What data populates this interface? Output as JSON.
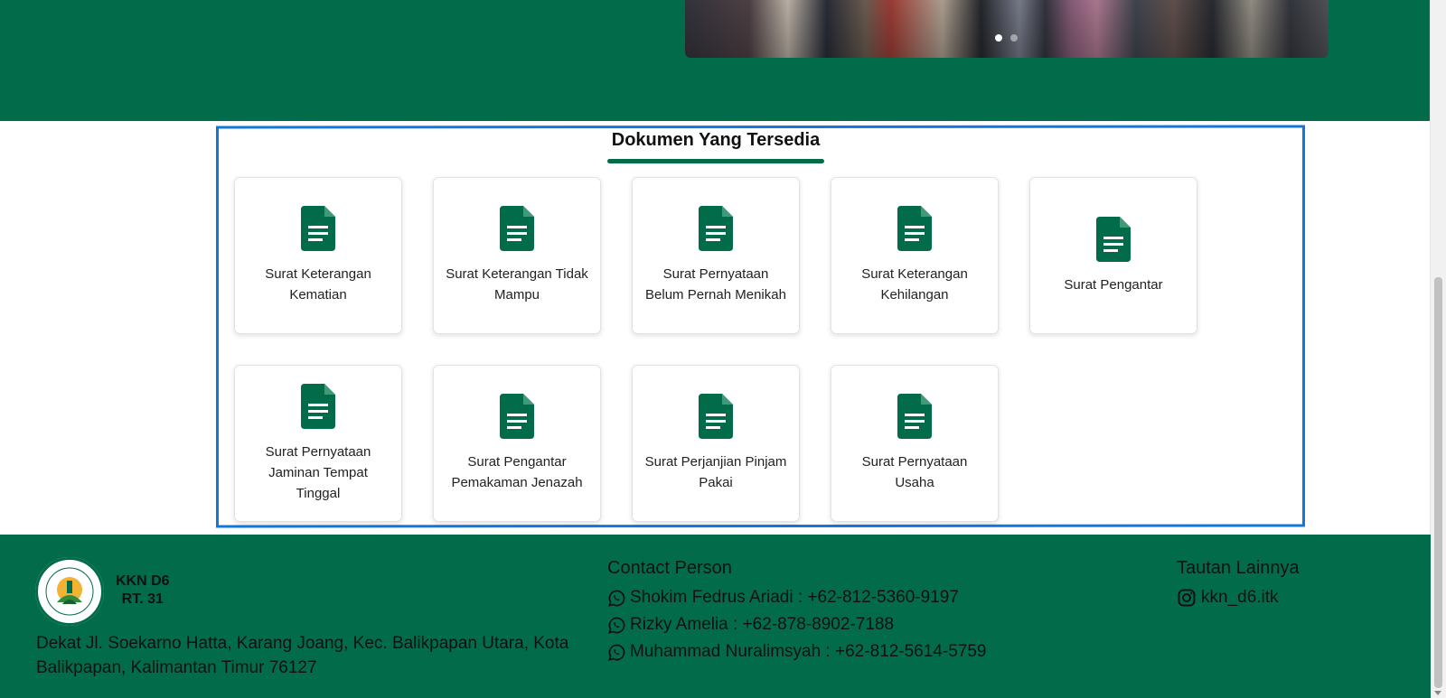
{
  "documents": {
    "title": "Dokumen Yang Tersedia",
    "items": [
      {
        "label": "Surat Keterangan Kematian"
      },
      {
        "label": "Surat Keterangan Tidak Mampu"
      },
      {
        "label": "Surat Pernyataan Belum Pernah Menikah"
      },
      {
        "label": "Surat Keterangan Kehilangan"
      },
      {
        "label": "Surat Pengantar"
      },
      {
        "label": "Surat Pernyataan Jaminan Tempat Tinggal"
      },
      {
        "label": "Surat Pengantar Pemakaman Jenazah"
      },
      {
        "label": "Surat Perjanjian Pinjam Pakai"
      },
      {
        "label": "Surat Pernyataan Usaha"
      }
    ]
  },
  "footer": {
    "org_line1": "KKN D6",
    "org_line2": "RT. 31",
    "address": "Dekat Jl. Soekarno Hatta, Karang Joang, Kec. Balikpapan Utara, Kota Balikpapan, Kalimantan Timur 76127",
    "contact_title": "Contact Person",
    "contacts": [
      {
        "text": "Shokim Fedrus Ariadi : +62-812-5360-9197"
      },
      {
        "text": "Rizky Amelia : +62-878-8902-7188"
      },
      {
        "text": "Muhammad Nuralimsyah : +62-812-5614-5759"
      }
    ],
    "links_title": "Tautan Lainnya",
    "instagram": "kkn_d6.itk"
  },
  "colors": {
    "brand_green": "#026c4a",
    "highlight_blue": "#1177dd"
  },
  "icons": {
    "document": "document-icon",
    "whatsapp": "whatsapp-icon",
    "instagram": "instagram-icon"
  }
}
